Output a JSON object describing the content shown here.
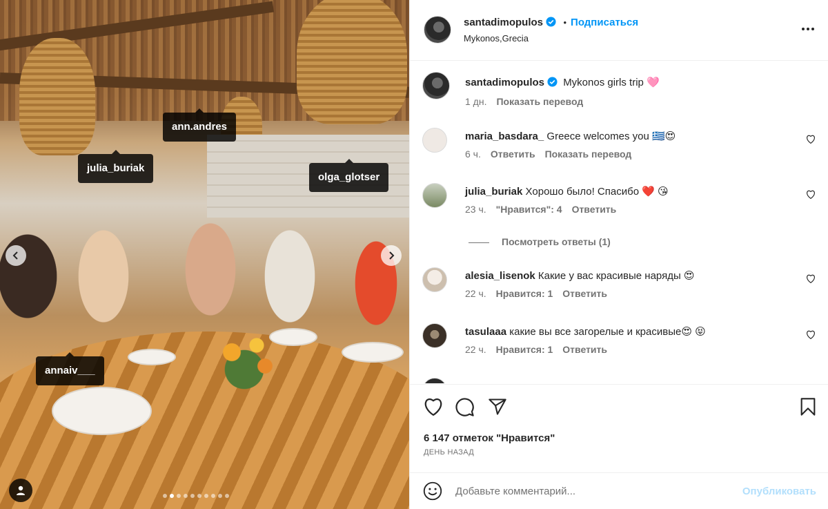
{
  "post": {
    "author": "santadimopulos",
    "follow_label": "Подписаться",
    "separator": "•",
    "location": "Mykonos,Grecia",
    "icons": {
      "verified": "verified-badge-icon",
      "more": "more-options-icon"
    }
  },
  "photo": {
    "tags": [
      "ann.andres",
      "julia_buriak",
      "olga_glotser",
      "annaiv___"
    ],
    "dots_count": 10,
    "active_dot": 1,
    "icons": {
      "prev": "chevron-left-icon",
      "next": "chevron-right-icon",
      "user_tags": "person-icon"
    }
  },
  "caption": {
    "author": "santadimopulos",
    "text": "Mykonos girls trip 🩷",
    "time": "1 дн.",
    "translate": "Показать перевод"
  },
  "comments": [
    {
      "author": "maria_basdara_",
      "text": "Greece welcomes you 🇬🇷😍",
      "time": "6 ч.",
      "likes": "",
      "reply": "Ответить",
      "translate": "Показать перевод",
      "avatar_color": "#efe9e4"
    },
    {
      "author": "julia_buriak",
      "text": "Хорошо было! Спасибо ❤️ 😘",
      "time": "23 ч.",
      "likes": "\"Нравится\": 4",
      "reply": "Ответить",
      "translate": "",
      "avatar_color": "#7a8a63",
      "view_replies": "Посмотреть ответы (1)"
    },
    {
      "author": "alesia_lisenok",
      "text": "Какие у вас красивые наряды 😍",
      "time": "22 ч.",
      "likes": "Нравится: 1",
      "reply": "Ответить",
      "translate": "",
      "avatar_color": "#e7ddd2"
    },
    {
      "author": "tasulaaa",
      "text": "какие вы все загорелые и красивые😍 😝",
      "time": "22 ч.",
      "likes": "Нравится: 1",
      "reply": "Ответить",
      "translate": "",
      "avatar_color": "#3b3027"
    }
  ],
  "actions": {
    "likes": "6 147 отметок \"Нравится\"",
    "date": "ДЕНЬ НАЗАД",
    "icons": [
      "heart-icon",
      "comment-icon",
      "share-icon",
      "bookmark-icon"
    ]
  },
  "add_comment": {
    "placeholder": "Добавьте комментарий...",
    "publish": "Опубликовать",
    "emoji_icon": "emoji-icon"
  },
  "colors": {
    "accent": "#0095f6",
    "verified": "#0095f6",
    "muted": "#737373",
    "publish_disabled": "#b2dffc"
  }
}
